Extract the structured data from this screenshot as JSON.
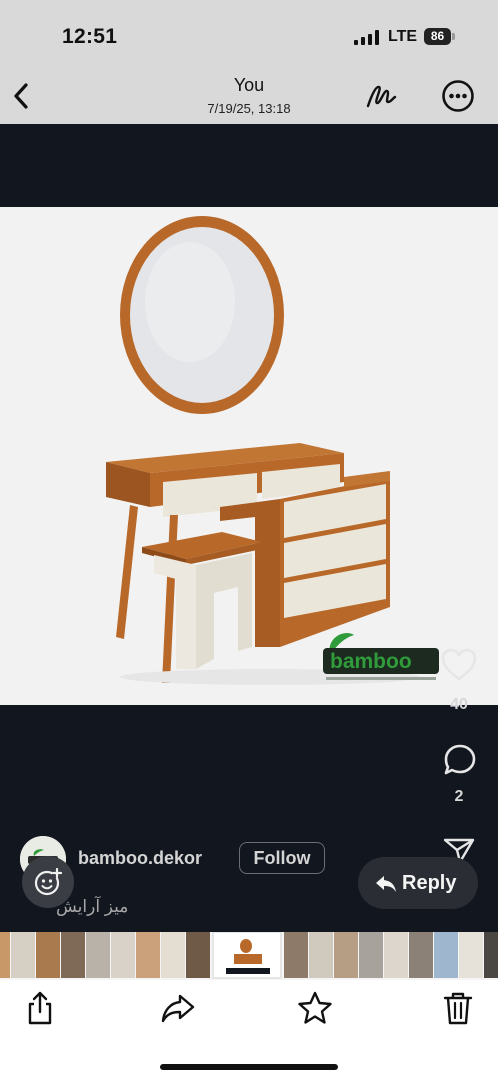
{
  "status_bar": {
    "time": "12:51",
    "network": "LTE",
    "battery": "86"
  },
  "header": {
    "title": "You",
    "subtitle": "7/19/25, 13:18"
  },
  "photo": {
    "description_icon": "vanity-dresser-photo",
    "brand_logo_text": "bamboo"
  },
  "actions": {
    "like_count": "40",
    "comment_count": "2"
  },
  "post": {
    "username": "bamboo.dekor",
    "follow_label": "Follow",
    "caption": "میز آرایش"
  },
  "reply": {
    "label": "Reply"
  },
  "toolbar": {
    "items": [
      "share-icon",
      "forward-icon",
      "star-icon",
      "trash-icon"
    ]
  },
  "colors": {
    "header_bg": "#d9d9d9",
    "viewer_bg": "#12161f",
    "wood": "#b8692a",
    "cream": "#ece8df",
    "brand_green": "#2f9b3a"
  }
}
